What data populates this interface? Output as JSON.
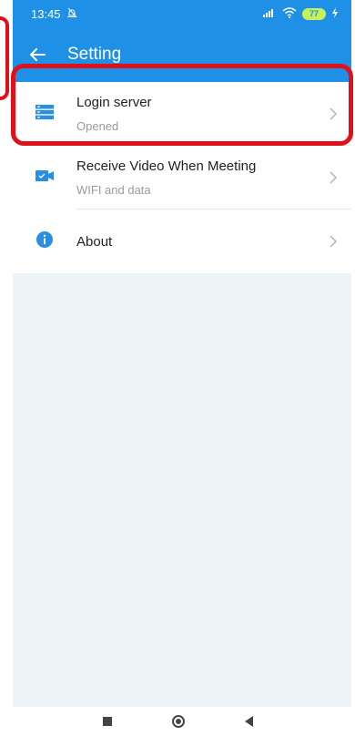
{
  "statusbar": {
    "time": "13:45",
    "battery": "77"
  },
  "appbar": {
    "title": "Setting"
  },
  "settings": {
    "items": [
      {
        "title": "Login server",
        "subtitle": "Opened"
      },
      {
        "title": "Receive Video When Meeting",
        "subtitle": "WIFI and data"
      },
      {
        "title": "About"
      }
    ]
  },
  "colors": {
    "accent": "#1e90e6",
    "highlight": "#e0101a",
    "background": "#eef3f8"
  },
  "icons": {
    "login_server": "server-icon",
    "receive_video": "video-camera-icon",
    "about": "info-icon"
  }
}
